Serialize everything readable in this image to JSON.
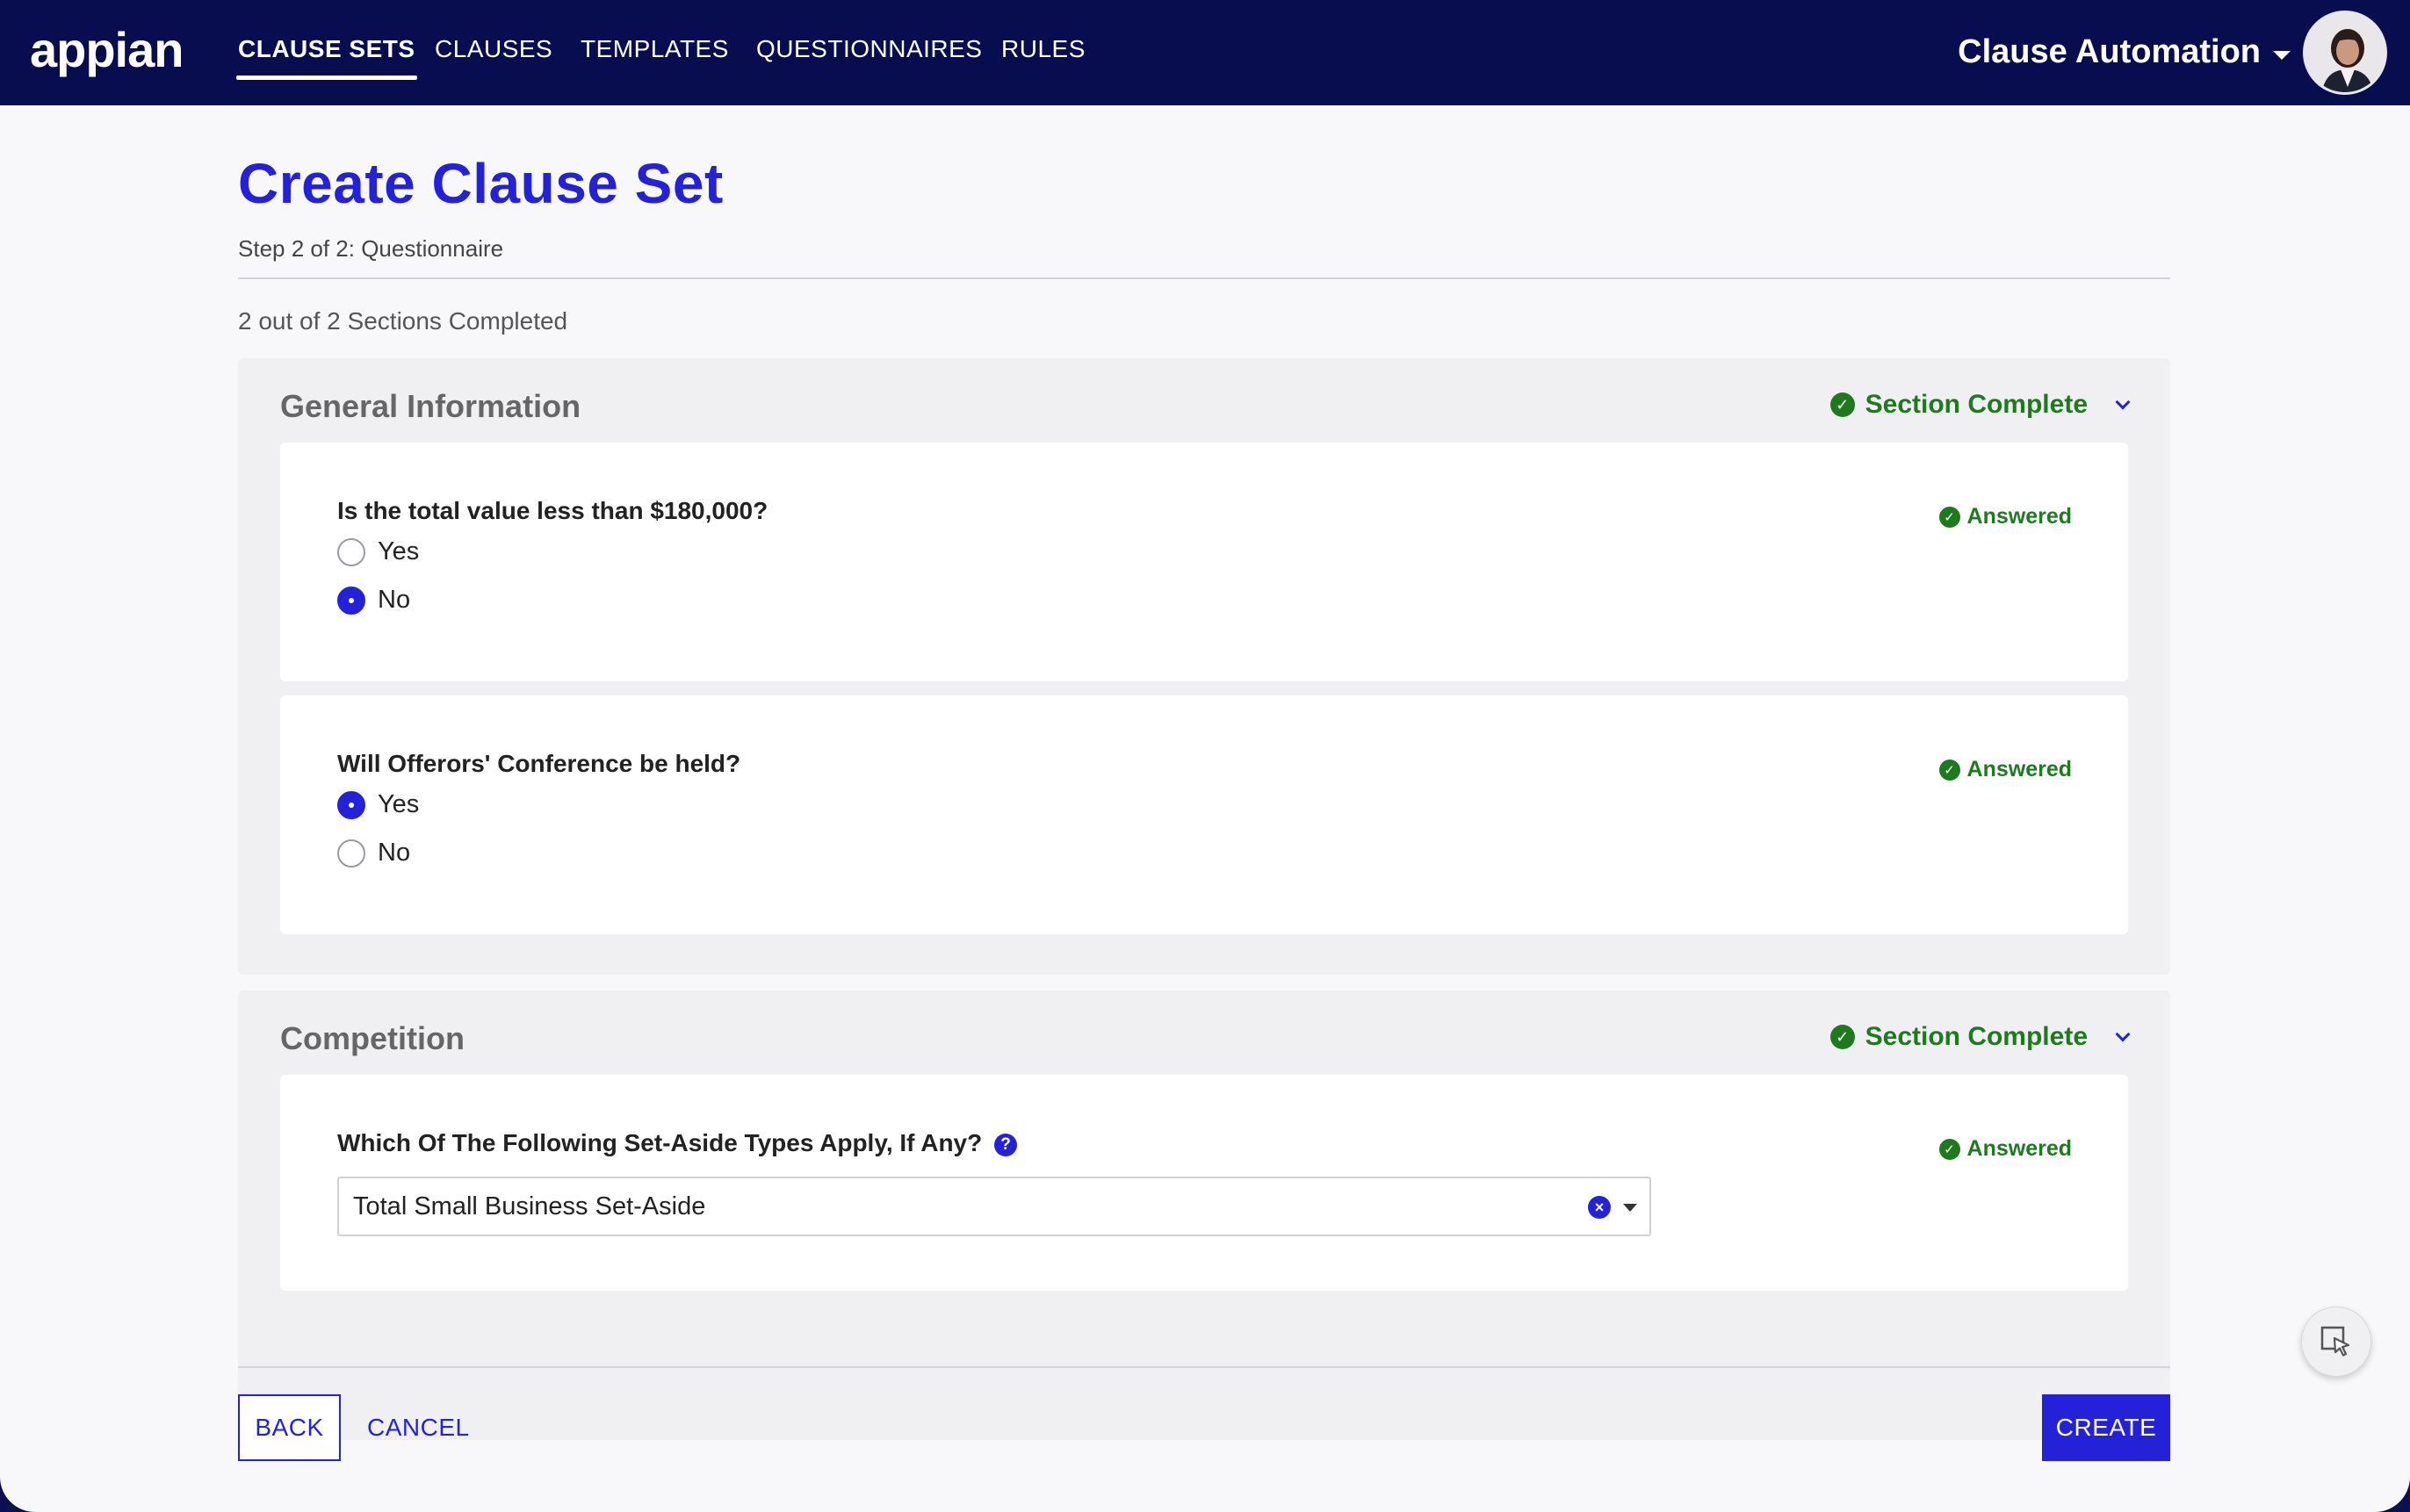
{
  "nav": {
    "logo": "appian",
    "tabs": [
      {
        "label": "CLAUSE SETS",
        "active": true
      },
      {
        "label": "CLAUSES",
        "active": false
      },
      {
        "label": "TEMPLATES",
        "active": false
      },
      {
        "label": "QUESTIONNAIRES",
        "active": false
      },
      {
        "label": "RULES",
        "active": false
      }
    ],
    "app_name": "Clause Automation"
  },
  "page": {
    "title": "Create Clause Set",
    "subtitle": "Step 2 of 2: Questionnaire",
    "progress": "2 out of 2 Sections Completed"
  },
  "sections": [
    {
      "title": "General Information",
      "status": "Section Complete",
      "questions": [
        {
          "text": "Is the total value less than $180,000?",
          "status": "Answered",
          "options": [
            {
              "label": "Yes",
              "selected": false
            },
            {
              "label": "No",
              "selected": true
            }
          ]
        },
        {
          "text": "Will Offerors' Conference be held?",
          "status": "Answered",
          "options": [
            {
              "label": "Yes",
              "selected": true
            },
            {
              "label": "No",
              "selected": false
            }
          ]
        }
      ]
    },
    {
      "title": "Competition",
      "status": "Section Complete",
      "questions": [
        {
          "text": "Which Of The Following Set-Aside Types Apply, If Any?",
          "status": "Answered",
          "dropdown_value": "Total Small Business Set-Aside"
        }
      ]
    }
  ],
  "footer": {
    "back_label": "BACK",
    "cancel_label": "CANCEL",
    "create_label": "CREATE"
  },
  "colors": {
    "nav_bg": "#070d4f",
    "accent": "#2322d8",
    "success": "#1f7a1f"
  },
  "icons": {
    "section_status": "check-circle-icon",
    "collapse": "chevron-down-icon",
    "help": "question-circle-icon",
    "clear": "clear-circle-icon",
    "fab": "cursor-select-icon"
  }
}
